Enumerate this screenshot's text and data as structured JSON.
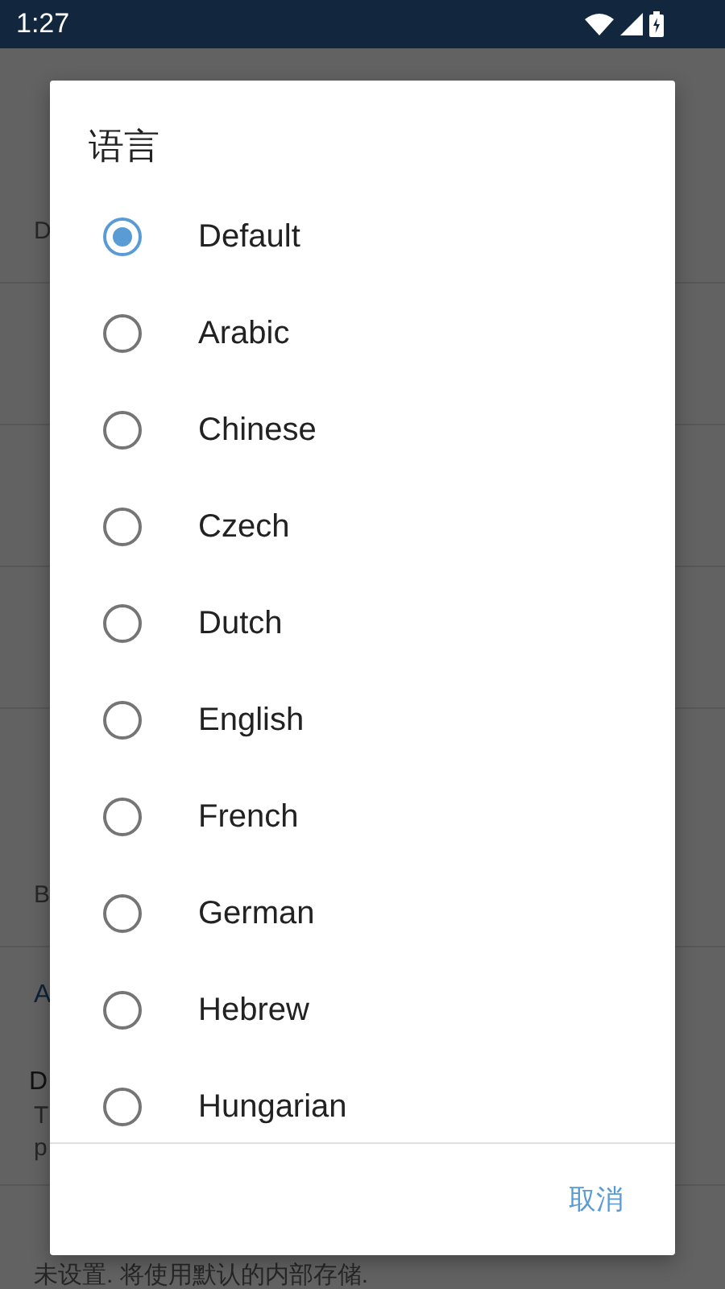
{
  "status_bar": {
    "time": "1:27"
  },
  "background_list": [
    {
      "kind": "header"
    },
    {
      "kind": "item",
      "subtitle": "D"
    },
    {
      "kind": "item"
    },
    {
      "kind": "item"
    },
    {
      "kind": "item"
    },
    {
      "kind": "header"
    },
    {
      "kind": "item",
      "subtitle": "B"
    },
    {
      "kind": "header",
      "title": "A"
    },
    {
      "kind": "item",
      "title": "D",
      "subtitle": "T",
      "subtitle_2": "p"
    },
    {
      "kind": "item",
      "subtitle": "未设置. 将使用默认的内部存储."
    }
  ],
  "dialog": {
    "title": "语言",
    "options": [
      {
        "label": "Default",
        "selected": true
      },
      {
        "label": "Arabic",
        "selected": false
      },
      {
        "label": "Chinese",
        "selected": false
      },
      {
        "label": "Czech",
        "selected": false
      },
      {
        "label": "Dutch",
        "selected": false
      },
      {
        "label": "English",
        "selected": false
      },
      {
        "label": "French",
        "selected": false
      },
      {
        "label": "German",
        "selected": false
      },
      {
        "label": "Hebrew",
        "selected": false
      },
      {
        "label": "Hungarian",
        "selected": false
      }
    ],
    "buttons": [
      "取消"
    ]
  }
}
